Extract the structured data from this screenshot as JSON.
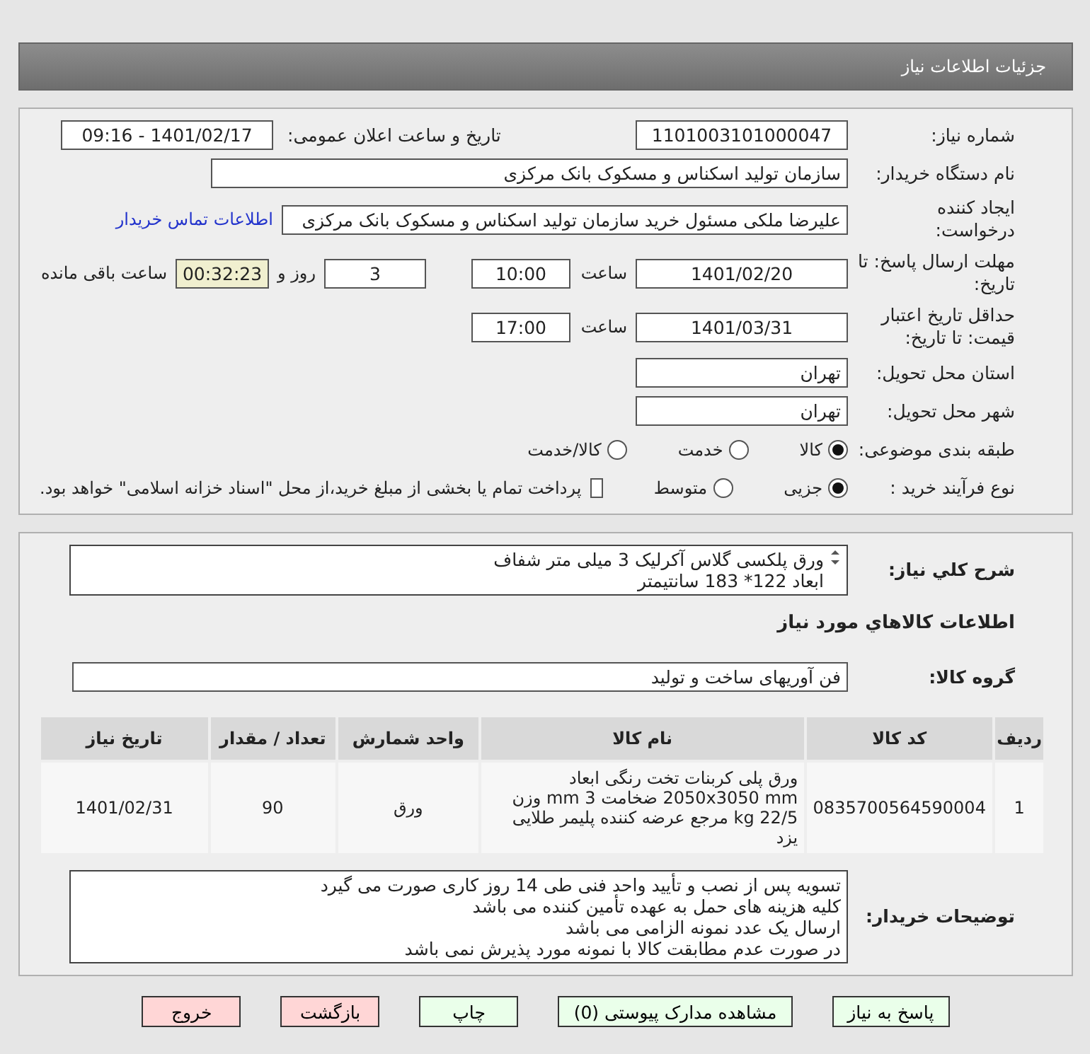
{
  "header": {
    "title": "جزئیات اطلاعات نیاز"
  },
  "details": {
    "need_number": {
      "label": "شماره نیاز:",
      "value": "1101003101000047"
    },
    "announce": {
      "label": "تاریخ و ساعت اعلان عمومی:",
      "value": "1401/02/17 - 09:16"
    },
    "buyer_org": {
      "label": "نام دستگاه خریدار:",
      "value": "سازمان تولید اسکناس و مسکوک بانک مرکزی"
    },
    "requester": {
      "label": "ایجاد کننده درخواست:",
      "value": "علیرضا ملکی مسئول خرید سازمان تولید اسکناس و مسکوک بانک مرکزی",
      "link": "اطلاعات تماس خریدار"
    },
    "reply_deadline": {
      "label": "مهلت ارسال پاسخ: تا تاریخ:",
      "date": "1401/02/20",
      "time_label": "ساعت",
      "time": "10:00",
      "days": "3",
      "days_label": "روز و",
      "remaining": "00:32:23",
      "remaining_label": "ساعت باقی مانده"
    },
    "price_validity": {
      "label": "حداقل تاریخ اعتبار قیمت: تا تاریخ:",
      "date": "1401/03/31",
      "time_label": "ساعت",
      "time": "17:00"
    },
    "province": {
      "label": "استان محل تحویل:",
      "value": "تهران"
    },
    "city": {
      "label": "شهر محل تحویل:",
      "value": "تهران"
    },
    "category": {
      "label": "طبقه بندی موضوعی:",
      "options": [
        {
          "label": "کالا",
          "selected": true
        },
        {
          "label": "خدمت",
          "selected": false
        },
        {
          "label": "کالا/خدمت",
          "selected": false
        }
      ]
    },
    "process": {
      "label": "نوع فرآیند خرید :",
      "options": [
        {
          "label": "جزیی",
          "selected": true
        },
        {
          "label": "متوسط",
          "selected": false
        }
      ],
      "payment": {
        "checked": false,
        "text": "پرداخت تمام یا بخشی از مبلغ خرید،از محل \"اسناد خزانه اسلامی\" خواهد بود."
      }
    }
  },
  "goods": {
    "description": {
      "label": "شرح کلي نياز:",
      "lines": [
        "ورق پلکسی گلاس آکرلیک 3 میلی متر شفاف",
        "ابعاد 122* 183 سانتیمتر"
      ]
    },
    "heading": "اطلاعات کالاهاي مورد نياز",
    "group": {
      "label": "گروه کالا:",
      "value": "فن آوریهای ساخت و تولید"
    },
    "table": {
      "columns": [
        "ردیف",
        "کد کالا",
        "نام کالا",
        "واحد شمارش",
        "تعداد / مقدار",
        "تاریخ نیاز"
      ],
      "rows": [
        [
          "1",
          "0835700564590004",
          "ورق پلی کربنات تخت رنگی ابعاد 2050x3050 mm ضخامت 3 mm وزن 22/5 kg مرجع عرضه کننده پلیمر طلایی یزد",
          "ورق",
          "90",
          "1401/02/31"
        ]
      ]
    },
    "notes": {
      "label": "توضیحات خریدار:",
      "lines": [
        "تسویه پس از نصب و تأیید واحد فنی طی 14 روز کاری صورت می گیرد",
        "کلیه هزینه های حمل به عهده تأمین کننده می باشد",
        "ارسال یک عدد نمونه الزامی می باشد",
        "در صورت عدم مطابقت کالا با نمونه مورد پذیرش نمی باشد"
      ]
    }
  },
  "buttons": [
    {
      "label": "پاسخ به نیاز",
      "kind": "action"
    },
    {
      "label": "مشاهده مدارک پیوستی (0)",
      "kind": "action"
    },
    {
      "label": "چاپ",
      "kind": "action"
    },
    {
      "label": "بازگشت",
      "kind": "exit"
    },
    {
      "label": "خروج",
      "kind": "exit"
    }
  ]
}
